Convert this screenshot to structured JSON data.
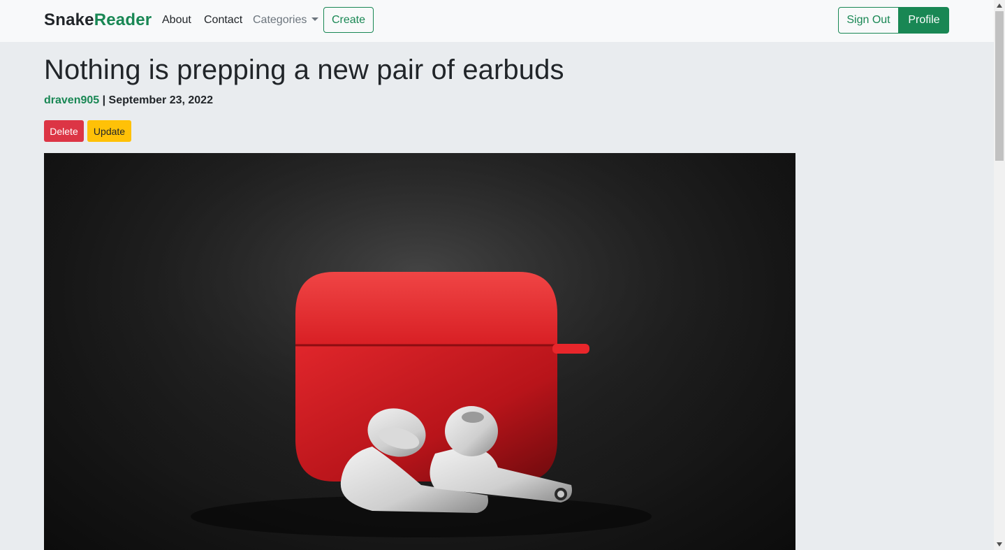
{
  "navbar": {
    "brand_part1": "Snake",
    "brand_part2": "Reader",
    "links": {
      "about": "About",
      "contact": "Contact",
      "categories": "Categories"
    },
    "create_label": "Create",
    "signout_label": "Sign Out",
    "profile_label": "Profile"
  },
  "post": {
    "title": "Nothing is prepping a new pair of earbuds",
    "author": "draven905",
    "separator": " | ",
    "date": "September 23, 2022",
    "delete_label": "Delete",
    "update_label": "Update",
    "image_alt": "Red earbuds charging case with two white wireless earbuds on a dark background"
  },
  "colors": {
    "brand_accent": "#198754",
    "danger": "#dc3545",
    "warning": "#ffc107",
    "page_bg": "#e9ecef",
    "navbar_bg": "#f8f9fa"
  },
  "icons": {
    "categories_caret": "caret-down-icon",
    "scroll_up": "scroll-up-arrow-icon",
    "scroll_down": "scroll-down-arrow-icon"
  }
}
